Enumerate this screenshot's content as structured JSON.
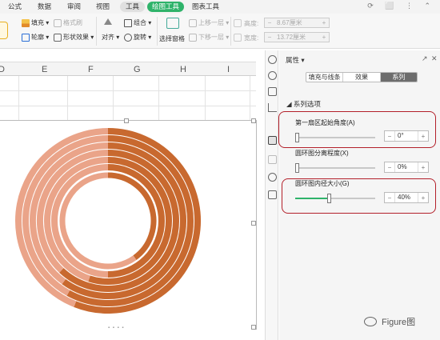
{
  "ribbon_tabs": [
    "公式",
    "数据",
    "审阅",
    "视图",
    "工具",
    "绘图工具",
    "图表工具"
  ],
  "ribbon": {
    "fill_label": "填充",
    "format_brush_label": "格式刷",
    "outline_label": "轮廓",
    "shape_effect_label": "形状效果",
    "align_label": "对齐",
    "group_label": "组合",
    "rotate_label": "旋转",
    "select_pane_label": "选择窗格",
    "bring_forward_label": "上移一层",
    "send_backward_label": "下移一层",
    "height_label": "高度:",
    "height_value": "8.67厘米",
    "width_label": "宽度:",
    "width_value": "13.72厘米"
  },
  "columns": [
    "D",
    "E",
    "F",
    "G",
    "H",
    "I"
  ],
  "panel": {
    "title": "属性",
    "tabs": [
      "填充与线条",
      "效果",
      "系列"
    ],
    "active_tab": "系列",
    "section": "系列选项",
    "first_slice_angle_label": "第一扇区起始角度(A)",
    "first_slice_angle_value": "0°",
    "first_slice_angle_fraction": 0.0,
    "explosion_label": "圆环图分离程度(X)",
    "explosion_value": "0%",
    "explosion_fraction": 0.0,
    "hole_size_label": "圆环图内径大小(G)",
    "hole_size_value": "40%",
    "hole_size_fraction": 0.4
  },
  "watermark_text": "Figure图",
  "colors": {
    "accent_green": "#2fb36a",
    "ring_dark": "#c8692f",
    "ring_light": "#eaa489",
    "highlight_red": "#b3202a"
  }
}
